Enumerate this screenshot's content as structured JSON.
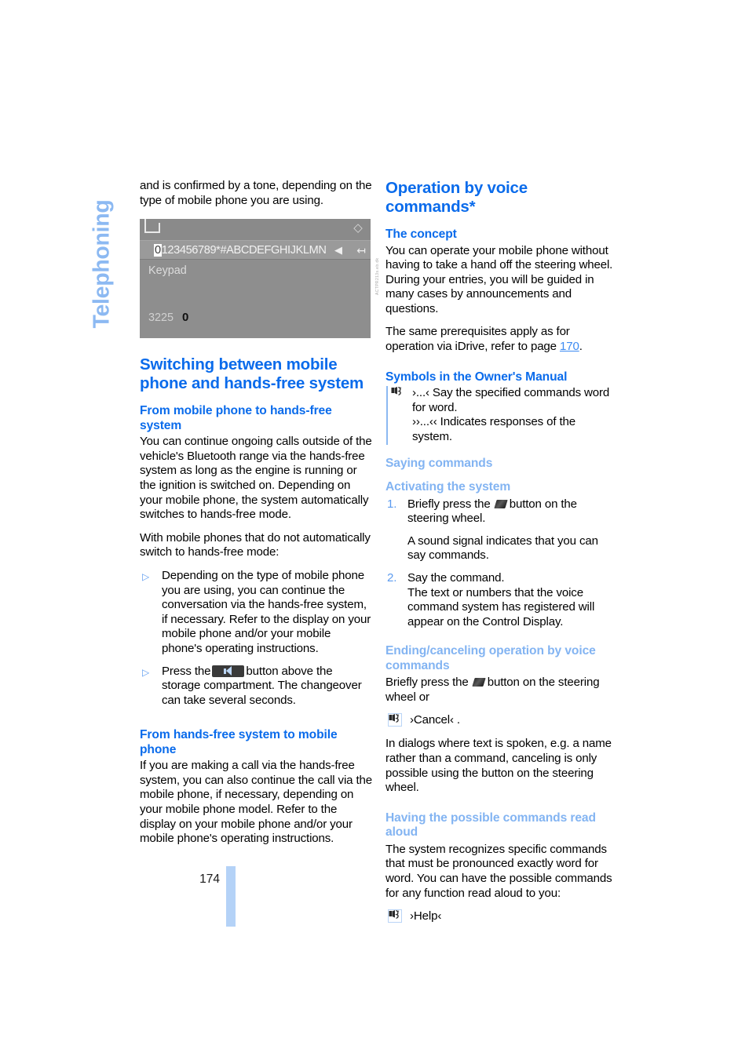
{
  "chapter": {
    "tab_label": "Telephoning"
  },
  "footer": {
    "page_number": "174"
  },
  "left_column": {
    "intro_paragraph": "and is confirmed by a tone, depending on the type of mobile phone you are using.",
    "screenshot": {
      "back_icon": "back-arrow-icon",
      "expand_icon": "expand-icon",
      "selected_char": "0",
      "character_strip": "123456789*#ABCDEFGHIJKLMN",
      "arrow_left_icon": "◀",
      "return_icon": "↤",
      "keypad_label": "Keypad",
      "extension": "3225",
      "entered_digit": "0",
      "caption": "ACTPR213s.eb.dk"
    },
    "heading": "Switching between mobile phone and hands-free system",
    "sub1": {
      "heading": "From mobile phone to hands-free system",
      "paragraph_1": "You can continue ongoing calls outside of the vehicle's Bluetooth range via the hands-free system as long as the engine is running or the ignition is switched on. Depending on your mobile phone, the system automatically switches to hands-free mode.",
      "paragraph_2": "With mobile phones that do not automatically switch to hands-free mode:",
      "bullets": [
        "Depending on the type of mobile phone you are using, you can continue the conversation via the hands-free system, if necessary. Refer to the display on your mobile phone and/or your mobile phone's operating instructions.",
        {
          "before": "Press the",
          "icon": "speaker-button-icon",
          "after": "button above the storage compartment. The changeover can take several seconds."
        }
      ]
    },
    "sub2": {
      "heading": "From hands-free system to mobile phone",
      "paragraph_1": "If you are making a call via the hands-free system, you can also continue the call via the mobile phone, if necessary, depending on your mobile phone model. Refer to the display on your mobile phone and/or your mobile phone's operating instructions."
    }
  },
  "right_column": {
    "heading": "Operation by voice commands*",
    "concept": {
      "heading": "The concept",
      "paragraph_1": "You can operate your mobile phone without having to take a hand off the steering wheel. During your entries, you will be guided in many cases by announcements and questions.",
      "paragraph_2_before": "The same prerequisites apply as for operation via iDrive, refer to page ",
      "paragraph_2_link": "170",
      "paragraph_2_after": "."
    },
    "symbols": {
      "heading": "Symbols in the Owner's Manual",
      "icon": "voice-command-icon",
      "line_1": "›...‹ Say the specified commands word for word.",
      "line_2": "››...‹‹ Indicates responses of the system."
    },
    "saying_commands": {
      "heading": "Saying commands"
    },
    "activating": {
      "heading": "Activating the system",
      "steps": [
        {
          "number": "1.",
          "before": "Briefly press the",
          "icon": "steering-wheel-button-icon",
          "after": "button on the steering wheel."
        },
        {
          "number": "2.",
          "text": "Say the command.\nThe text or numbers that the voice command system has registered will appear on the Control Display."
        }
      ],
      "note": "A sound signal indicates that you can say commands."
    },
    "ending": {
      "heading": "Ending/canceling operation by voice commands",
      "paragraph_before": "Briefly press the",
      "paragraph_icon": "steering-wheel-button-icon",
      "paragraph_after": "button on the steering wheel or",
      "command_icon": "voice-command-icon",
      "command_text": "›Cancel‹ .",
      "paragraph_2": "In dialogs where text is spoken, e.g. a name rather than a command, canceling is only possible using the button on the steering wheel."
    },
    "read_aloud": {
      "heading": "Having the possible commands read aloud",
      "paragraph_1": "The system recognizes specific commands that must be pronounced exactly word for word. You can have the possible commands for any function read aloud to you:",
      "command_icon": "voice-command-icon",
      "command_text": "›Help‹"
    }
  },
  "colors": {
    "heading_blue": "#0A6BEB",
    "subheading_light_blue": "#83B4F2",
    "tab_blue": "#8CB9F2",
    "link_blue": "#3D8BF2",
    "page_bar_blue": "#B4D2F7"
  }
}
